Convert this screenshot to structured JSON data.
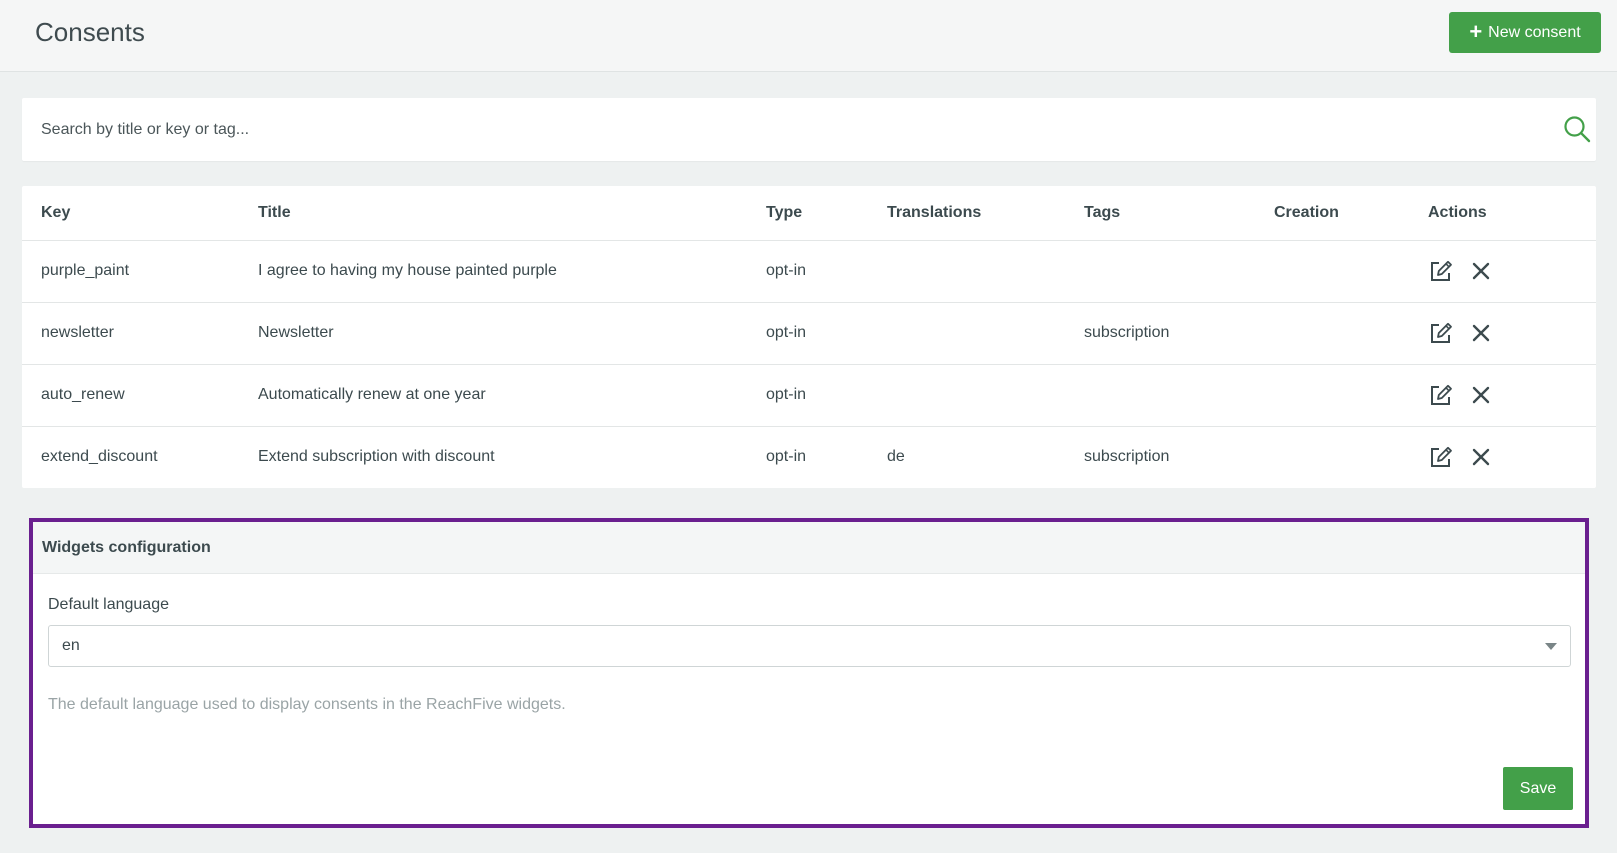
{
  "header": {
    "title": "Consents",
    "new_button_label": "New consent"
  },
  "search": {
    "placeholder": "Search by title or key or tag..."
  },
  "table": {
    "columns": {
      "key": "Key",
      "title": "Title",
      "type": "Type",
      "translations": "Translations",
      "tags": "Tags",
      "creation": "Creation",
      "actions": "Actions"
    },
    "rows": [
      {
        "key": "purple_paint",
        "title": "I agree to having my house painted purple",
        "type": "opt-in",
        "translations": "",
        "tags": "",
        "creation": ""
      },
      {
        "key": "newsletter",
        "title": "Newsletter",
        "type": "opt-in",
        "translations": "",
        "tags": "subscription",
        "creation": ""
      },
      {
        "key": "auto_renew",
        "title": "Automatically renew at one year",
        "type": "opt-in",
        "translations": "",
        "tags": "",
        "creation": ""
      },
      {
        "key": "extend_discount",
        "title": "Extend subscription with discount",
        "type": "opt-in",
        "translations": "de",
        "tags": "subscription",
        "creation": ""
      }
    ]
  },
  "widgets": {
    "title": "Widgets configuration",
    "language_label": "Default language",
    "language_value": "en",
    "help_text": "The default language used to display consents in the ReachFive widgets.",
    "save_label": "Save"
  },
  "colors": {
    "primary_green": "#43a049",
    "highlight_purple": "#6a1f8f"
  },
  "icons": {
    "new": "plus-icon",
    "search": "search-icon",
    "edit": "edit-icon",
    "delete": "close-icon",
    "select": "chevron-down-icon"
  }
}
